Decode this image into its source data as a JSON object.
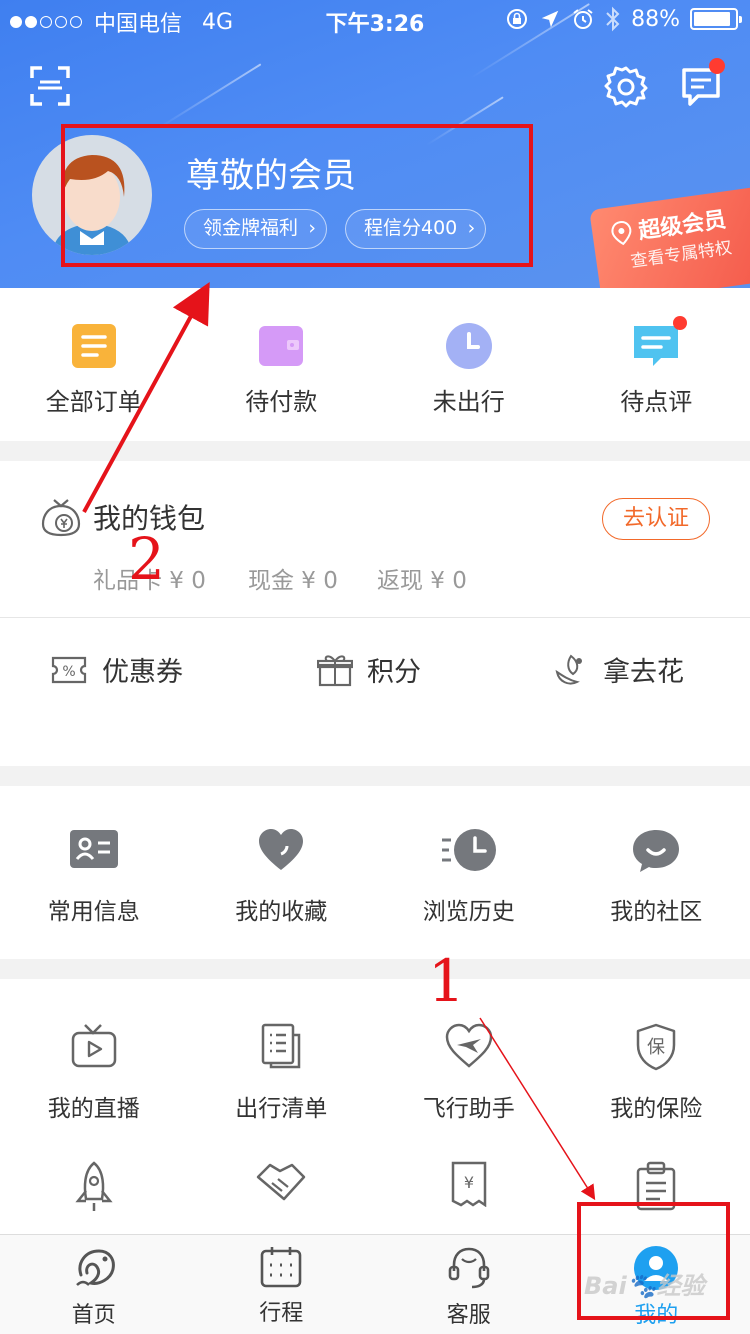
{
  "status_bar": {
    "carrier": "中国电信",
    "network": "4G",
    "time": "下午3:26",
    "battery": "88%"
  },
  "header": {
    "member_name": "尊敬的会员",
    "pill_gold": "领金牌福利",
    "pill_credit": "程信分400",
    "super_member_title": "超级会员",
    "super_member_sub": "查看专属特权"
  },
  "orders": [
    {
      "label": "全部订单",
      "icon": "orders-icon",
      "color": "#f9b33a"
    },
    {
      "label": "待付款",
      "icon": "wallet-icon",
      "color": "#d59af7"
    },
    {
      "label": "未出行",
      "icon": "clock-icon",
      "color": "#a3b1f5"
    },
    {
      "label": "待点评",
      "icon": "comment-icon",
      "color": "#4fc3f0"
    }
  ],
  "wallet": {
    "title": "我的钱包",
    "auth_button": "去认证",
    "gift_card": "礼品卡 ¥ 0",
    "cash": "现金 ¥ 0",
    "cashback": "返现 ¥ 0"
  },
  "assets": [
    {
      "label": "优惠券",
      "icon": "coupon-icon"
    },
    {
      "label": "积分",
      "icon": "gift-icon"
    },
    {
      "label": "拿去花",
      "icon": "flower-icon"
    }
  ],
  "tools": [
    {
      "label": "常用信息",
      "icon": "id-card-icon"
    },
    {
      "label": "我的收藏",
      "icon": "heart-icon"
    },
    {
      "label": "浏览历史",
      "icon": "history-icon"
    },
    {
      "label": "我的社区",
      "icon": "chat-bubble-icon"
    }
  ],
  "services": [
    {
      "label": "我的直播",
      "icon": "tv-icon"
    },
    {
      "label": "出行清单",
      "icon": "checklist-icon"
    },
    {
      "label": "飞行助手",
      "icon": "flight-icon"
    },
    {
      "label": "我的保险",
      "icon": "shield-icon"
    }
  ],
  "tabbar": [
    {
      "label": "首页",
      "icon": "dolphin-icon"
    },
    {
      "label": "行程",
      "icon": "calendar-icon"
    },
    {
      "label": "客服",
      "icon": "headset-icon"
    },
    {
      "label": "我的",
      "icon": "profile-icon",
      "active": true
    }
  ],
  "annotations": {
    "one": "1",
    "two": "2"
  },
  "colors": {
    "header_blue": "#4a86f2",
    "accent_orange": "#f2692a",
    "annotation_red": "#e5131a",
    "tab_active": "#1ea0f0"
  }
}
